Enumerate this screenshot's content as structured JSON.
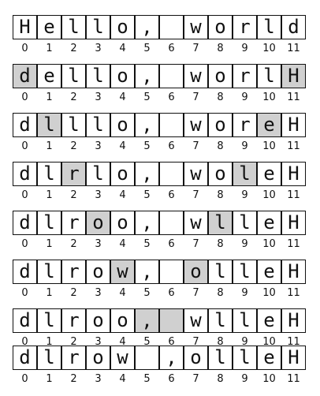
{
  "indices": [
    "0",
    "1",
    "2",
    "3",
    "4",
    "5",
    "6",
    "7",
    "8",
    "9",
    "10",
    "11"
  ],
  "highlight_color": "#d0d0d0",
  "steps": [
    {
      "chars": [
        "H",
        "e",
        "l",
        "l",
        "o",
        ",",
        " ",
        "w",
        "o",
        "r",
        "l",
        "d"
      ],
      "highlighted": []
    },
    {
      "chars": [
        "d",
        "e",
        "l",
        "l",
        "o",
        ",",
        " ",
        "w",
        "o",
        "r",
        "l",
        "H"
      ],
      "highlighted": [
        0,
        11
      ]
    },
    {
      "chars": [
        "d",
        "l",
        "l",
        "l",
        "o",
        ",",
        " ",
        "w",
        "o",
        "r",
        "e",
        "H"
      ],
      "highlighted": [
        1,
        10
      ]
    },
    {
      "chars": [
        "d",
        "l",
        "r",
        "l",
        "o",
        ",",
        " ",
        "w",
        "o",
        "l",
        "e",
        "H"
      ],
      "highlighted": [
        2,
        9
      ]
    },
    {
      "chars": [
        "d",
        "l",
        "r",
        "o",
        "o",
        ",",
        " ",
        "w",
        "l",
        "l",
        "e",
        "H"
      ],
      "highlighted": [
        3,
        8
      ]
    },
    {
      "chars": [
        "d",
        "l",
        "r",
        "o",
        "w",
        ",",
        " ",
        "o",
        "l",
        "l",
        "e",
        "H"
      ],
      "highlighted": [
        4,
        7
      ]
    },
    {
      "chars": [
        "d",
        "l",
        "r",
        "o",
        "o",
        ",",
        " ",
        "w",
        "l",
        "l",
        "e",
        "H"
      ],
      "highlighted": [
        5,
        6
      ]
    },
    {
      "chars": [
        "d",
        "l",
        "r",
        "o",
        "w",
        " ",
        ",",
        "o",
        "l",
        "l",
        "e",
        "H"
      ],
      "highlighted": []
    }
  ]
}
